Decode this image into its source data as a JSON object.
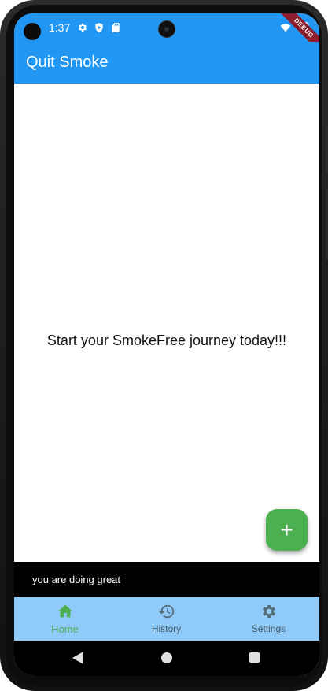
{
  "status_bar": {
    "time": "1:37",
    "icons": [
      "gear-icon",
      "shield-icon",
      "sd-card-icon",
      "wifi-icon",
      "battery-icon"
    ]
  },
  "debug_banner": "DEBUG",
  "app_bar": {
    "title": "Quit Smoke"
  },
  "body": {
    "message": "Start your SmokeFree journey today!!!"
  },
  "fab": {
    "icon": "plus-icon",
    "label": "+"
  },
  "snackbar": {
    "text": "you are doing great"
  },
  "bottom_nav": {
    "items": [
      {
        "label": "Home",
        "icon": "home-icon",
        "selected": true
      },
      {
        "label": "History",
        "icon": "history-icon",
        "selected": false
      },
      {
        "label": "Settings",
        "icon": "settings-icon",
        "selected": false
      }
    ]
  },
  "colors": {
    "primary": "#2196f3",
    "accent": "#4caf50",
    "nav_background": "#90caf9",
    "nav_selected": "#4caf50",
    "nav_unselected": "#546e7a"
  }
}
